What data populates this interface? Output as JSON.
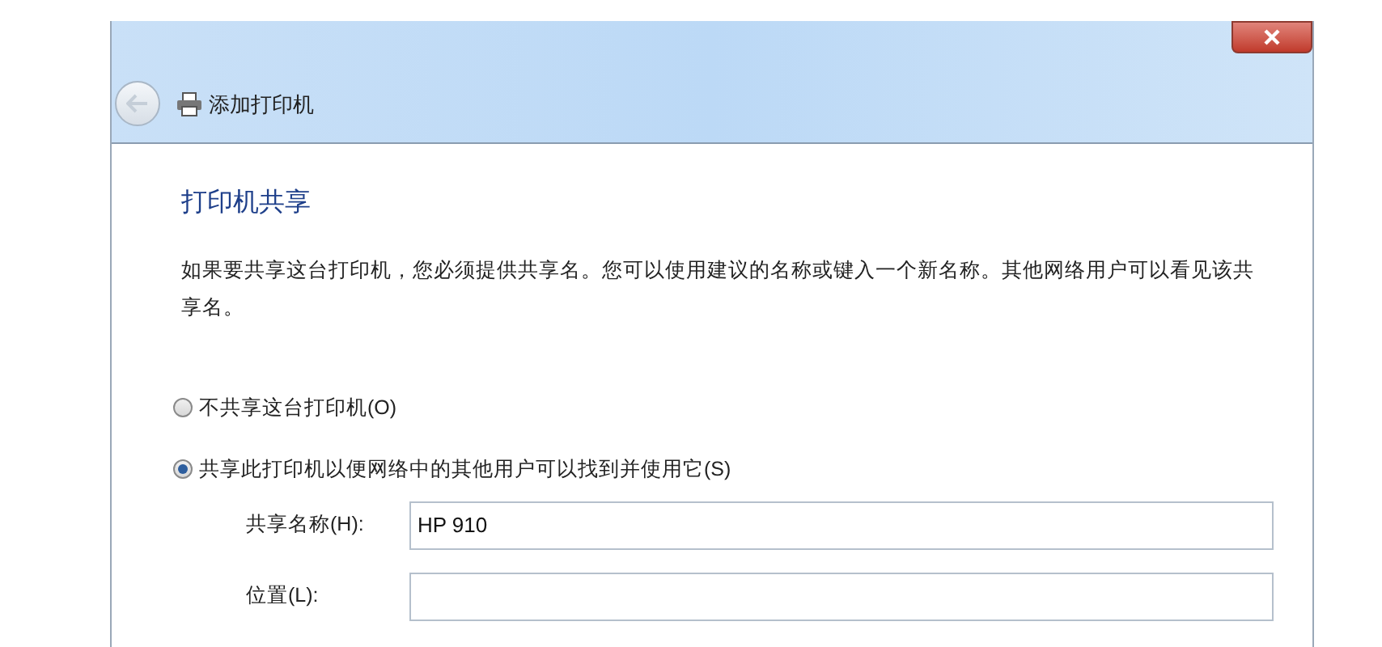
{
  "window": {
    "title": "添加打印机"
  },
  "heading": "打印机共享",
  "description": "如果要共享这台打印机，您必须提供共享名。您可以使用建议的名称或键入一个新名称。其他网络用户可以看见该共享名。",
  "options": [
    {
      "label": "不共享这台打印机(O)",
      "selected": false
    },
    {
      "label": "共享此打印机以便网络中的其他用户可以找到并使用它(S)",
      "selected": true
    }
  ],
  "fields": [
    {
      "label": "共享名称(H):",
      "value": "HP 910"
    },
    {
      "label": "位置(L):"
    }
  ]
}
